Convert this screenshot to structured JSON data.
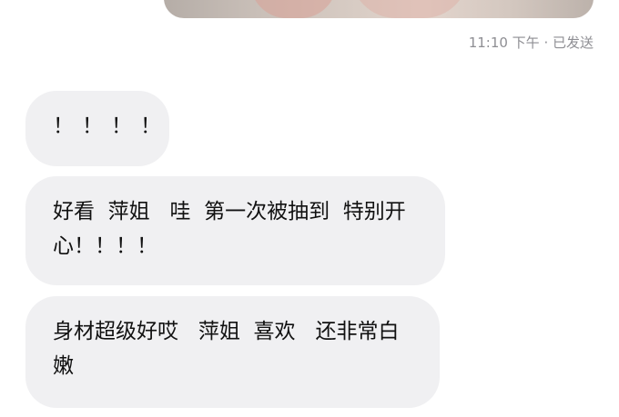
{
  "sent_message": {
    "status": "11:10 下午 · 已发送"
  },
  "received_messages": [
    {
      "lines": [
        "！！！！"
      ]
    },
    {
      "lines": [
        "好看  萍姐   哇  第一次被抽到  特别开",
        "心！！！！"
      ]
    },
    {
      "lines": [
        "身材超级好哎   萍姐  喜欢   还非常白",
        "嫩"
      ]
    }
  ]
}
